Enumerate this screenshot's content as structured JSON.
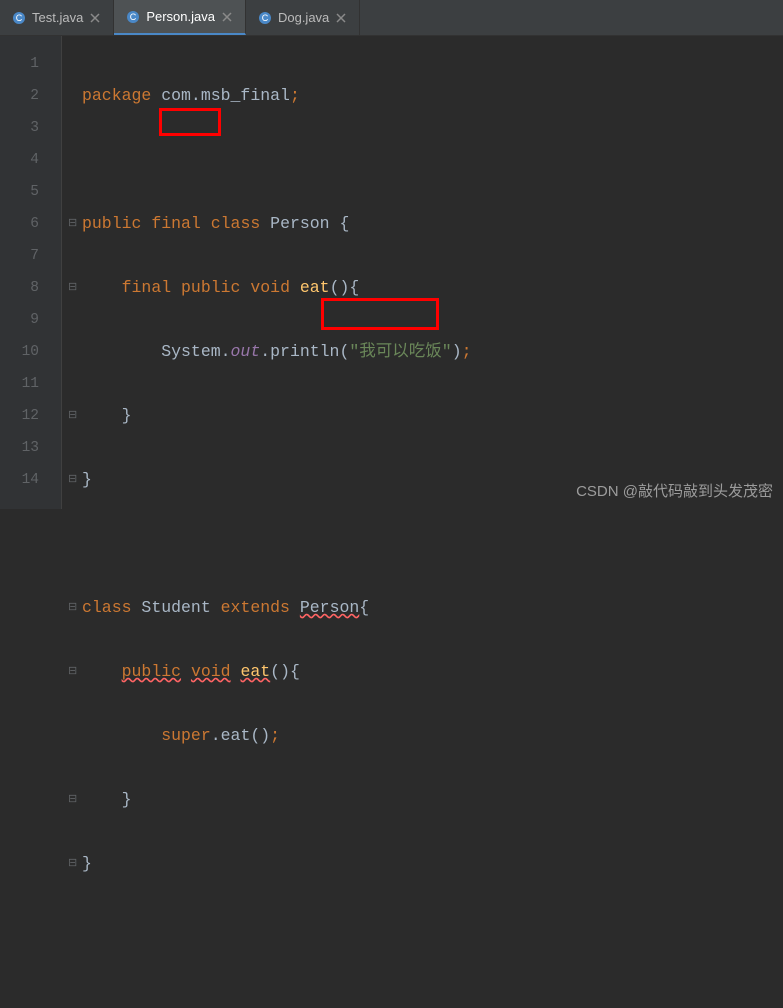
{
  "tabs": [
    {
      "label": "Test.java",
      "active": false
    },
    {
      "label": "Person.java",
      "active": true
    },
    {
      "label": "Dog.java",
      "active": false
    }
  ],
  "gutter": {
    "lines": [
      "1",
      "2",
      "3",
      "4",
      "5",
      "6",
      "7",
      "8",
      "9",
      "10",
      "11",
      "12",
      "13",
      "14"
    ]
  },
  "code": {
    "l1_kw": "package",
    "l1_pkg": " com.msb_final",
    "l1_sc": ";",
    "l3_public": "public",
    "l3_final": "final",
    "l3_classkw": "class",
    "l3_name": "Person {",
    "l4_final": "final",
    "l4_public": "public",
    "l4_void": "void",
    "l4_rest": "eat(){",
    "l4_eat": "eat",
    "l5_sys": "System.",
    "l5_out": "out",
    "l5_print": ".println(",
    "l5_str": "\"我可以吃饭\"",
    "l5_end": ")",
    "l5_sc": ";",
    "l6": "}",
    "l7": "}",
    "l9_classkw": "class",
    "l9_name": "Student",
    "l9_ext": "extends",
    "l9_par": "Person",
    "l9_brace": "{",
    "l10_public": "public",
    "l10_void": "void",
    "l10_eat": "eat",
    "l10_rest": "(){",
    "l11_super": "super",
    "l11_rest": ".eat()",
    "l11_sc": ";",
    "l12": "}",
    "l13": "}"
  },
  "watermark": "CSDN @敲代码敲到头发茂密"
}
